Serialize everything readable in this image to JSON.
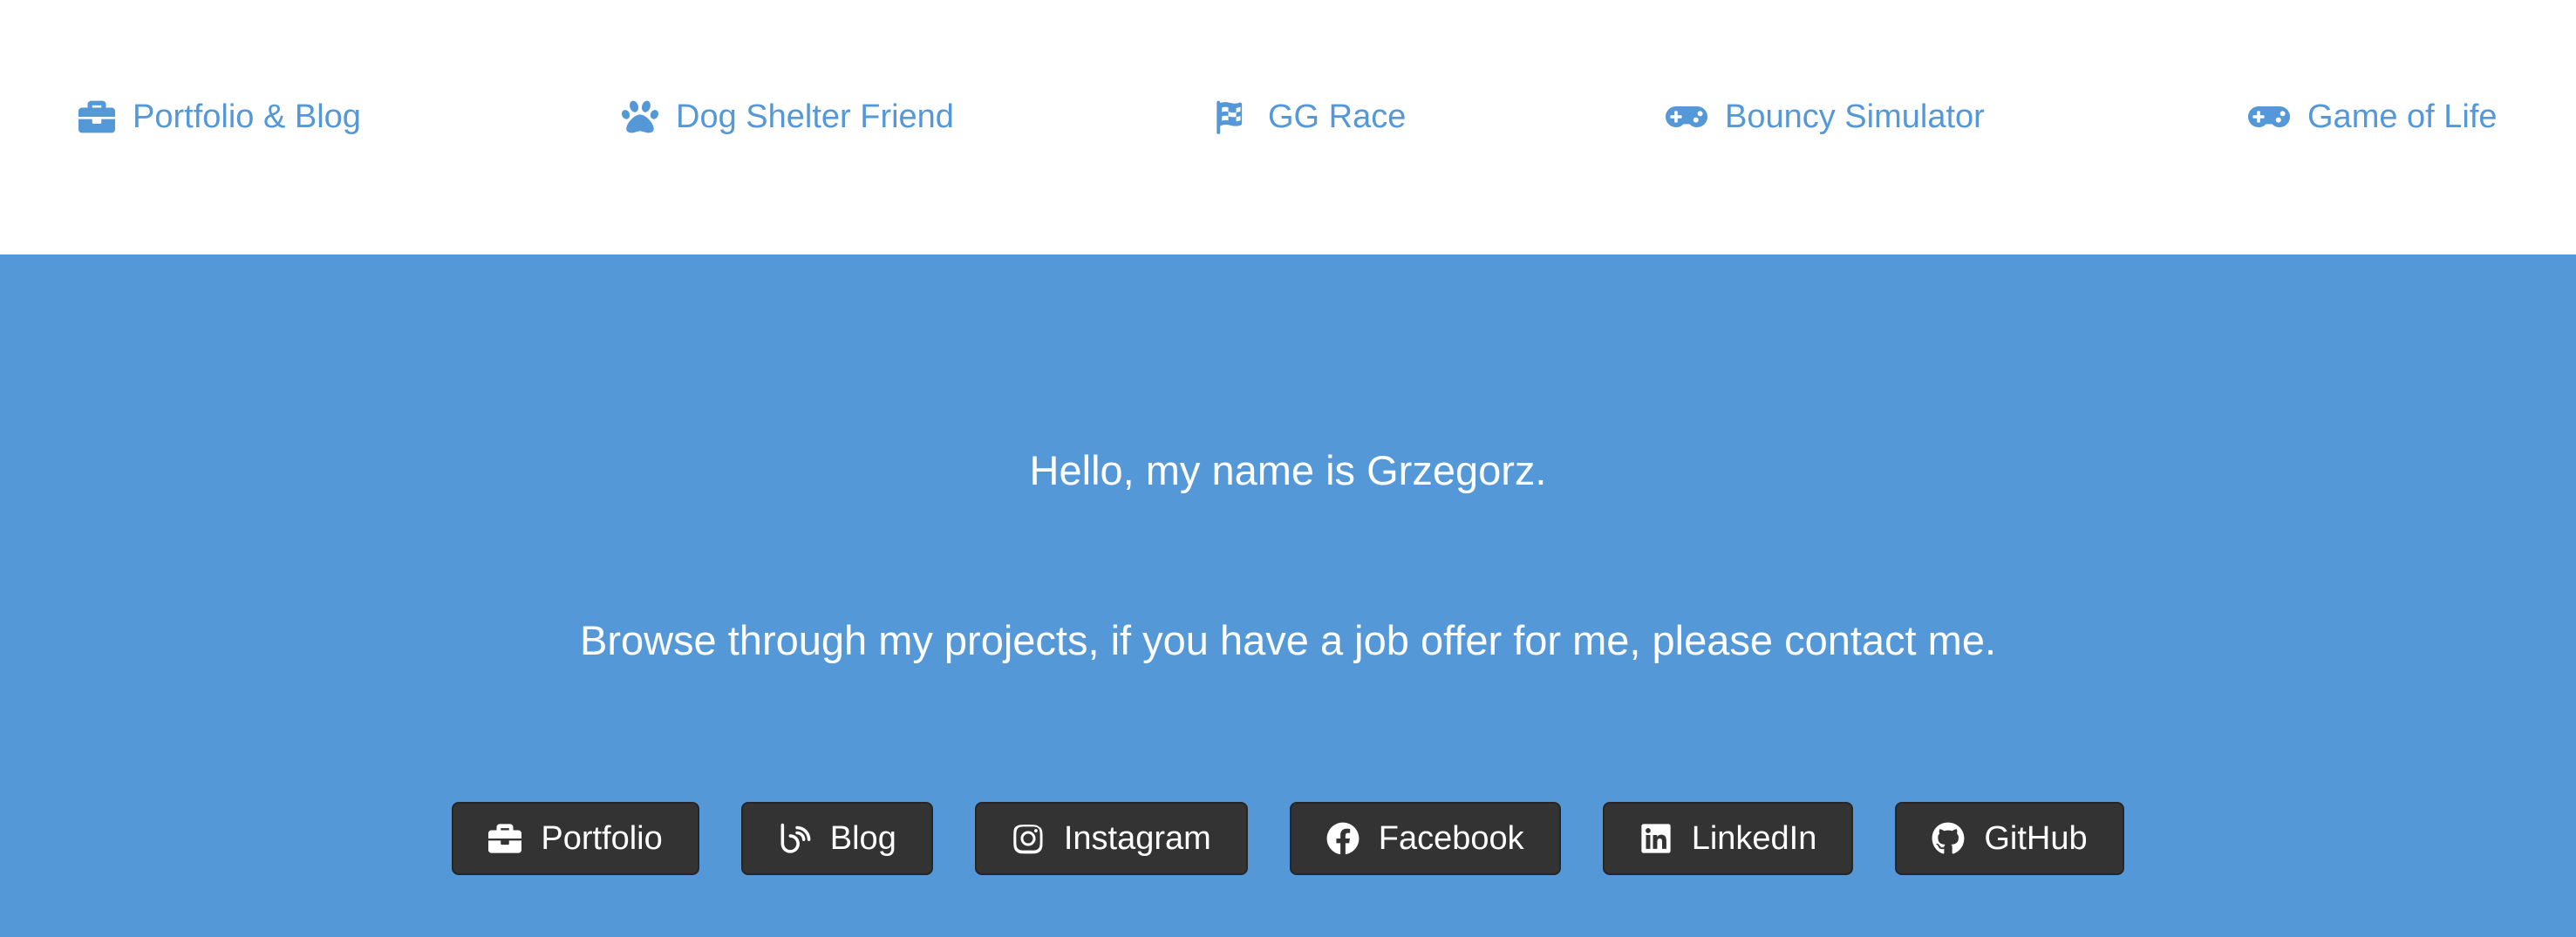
{
  "nav": {
    "items": [
      {
        "label": "Portfolio & Blog",
        "icon": "briefcase-icon"
      },
      {
        "label": "Dog Shelter Friend",
        "icon": "paw-icon"
      },
      {
        "label": "GG Race",
        "icon": "flag-checkered-icon"
      },
      {
        "label": "Bouncy Simulator",
        "icon": "gamepad-icon"
      },
      {
        "label": "Game of Life",
        "icon": "gamepad-icon"
      }
    ]
  },
  "hero": {
    "greeting": "Hello, my name is Grzegorz.",
    "tagline": "Browse through my projects, if you have a job offer for me, please contact me.",
    "buttons": [
      {
        "label": "Portfolio",
        "icon": "briefcase-icon"
      },
      {
        "label": "Blog",
        "icon": "blog-icon"
      },
      {
        "label": "Instagram",
        "icon": "instagram-icon"
      },
      {
        "label": "Facebook",
        "icon": "facebook-icon"
      },
      {
        "label": "LinkedIn",
        "icon": "linkedin-icon"
      },
      {
        "label": "GitHub",
        "icon": "github-icon"
      }
    ]
  },
  "colors": {
    "accent": "#5598d8",
    "button_bg": "#333333",
    "text_light": "#ffffff"
  }
}
